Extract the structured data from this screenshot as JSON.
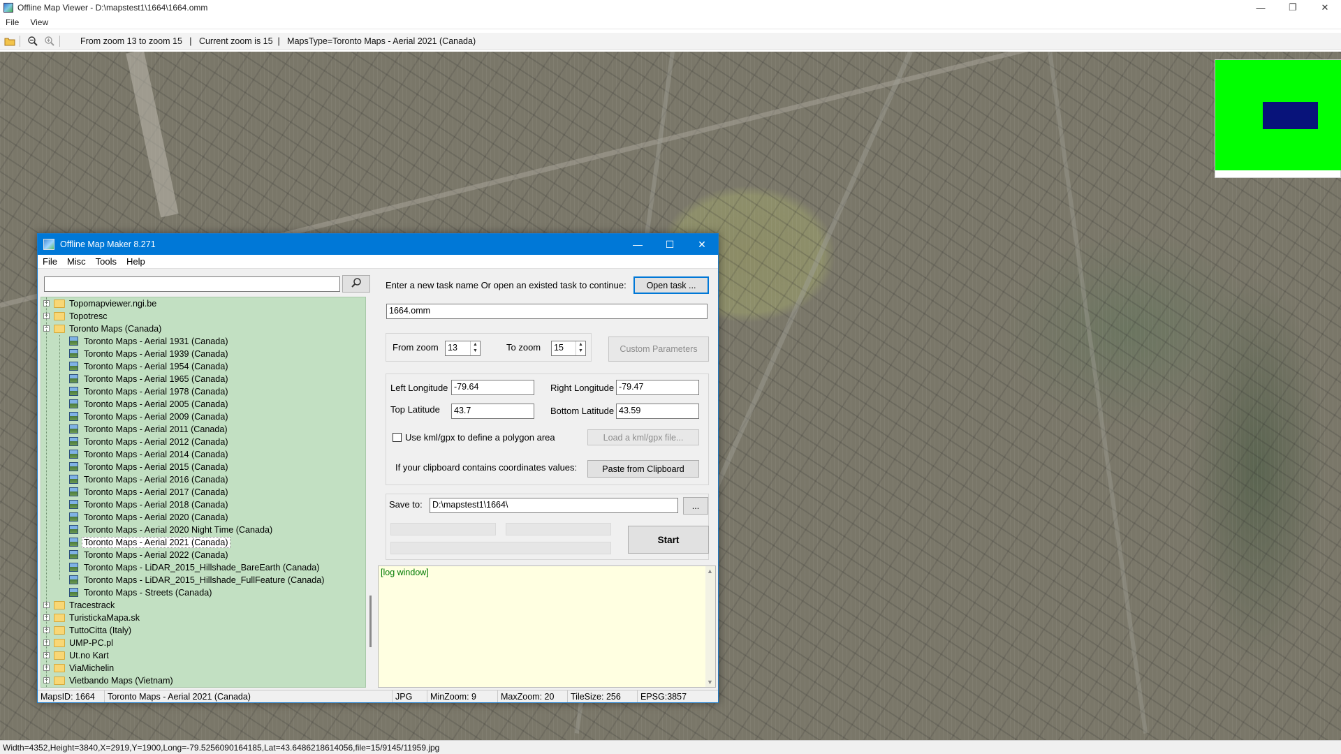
{
  "viewer": {
    "title": "Offline Map Viewer - D:\\mapstest1\\1664\\1664.omm",
    "menu": [
      "File",
      "View"
    ],
    "toolbar_info": "From zoom 13 to zoom 15   |   Current zoom is 15  |   MapsType=Toronto Maps - Aerial 2021 (Canada)",
    "status": "Width=4352,Height=3840,X=2919,Y=1900,Long=-79.5256090164185,Lat=43.6486218614056,file=15/9145/11959.jpg",
    "win_buttons": {
      "minimize": "—",
      "restore": "❐",
      "close": "✕"
    }
  },
  "dialog": {
    "title": "Offline Map Maker 8.271",
    "menu": [
      "File",
      "Misc",
      "Tools",
      "Help"
    ],
    "search_value": "",
    "tree": [
      {
        "label": "Topomapviewer.ngi.be",
        "type": "folder",
        "expanded": false
      },
      {
        "label": "Topotresc",
        "type": "folder",
        "expanded": false
      },
      {
        "label": "Toronto Maps (Canada)",
        "type": "folder",
        "expanded": true
      },
      {
        "label": "Toronto Maps - Aerial 1931 (Canada)",
        "type": "map"
      },
      {
        "label": "Toronto Maps - Aerial 1939 (Canada)",
        "type": "map"
      },
      {
        "label": "Toronto Maps - Aerial 1954 (Canada)",
        "type": "map"
      },
      {
        "label": "Toronto Maps - Aerial 1965 (Canada)",
        "type": "map"
      },
      {
        "label": "Toronto Maps - Aerial 1978 (Canada)",
        "type": "map"
      },
      {
        "label": "Toronto Maps - Aerial 2005 (Canada)",
        "type": "map"
      },
      {
        "label": "Toronto Maps - Aerial 2009 (Canada)",
        "type": "map"
      },
      {
        "label": "Toronto Maps - Aerial 2011 (Canada)",
        "type": "map"
      },
      {
        "label": "Toronto Maps - Aerial 2012 (Canada)",
        "type": "map"
      },
      {
        "label": "Toronto Maps - Aerial 2014 (Canada)",
        "type": "map"
      },
      {
        "label": "Toronto Maps - Aerial 2015 (Canada)",
        "type": "map"
      },
      {
        "label": "Toronto Maps - Aerial 2016 (Canada)",
        "type": "map"
      },
      {
        "label": "Toronto Maps - Aerial 2017 (Canada)",
        "type": "map"
      },
      {
        "label": "Toronto Maps - Aerial 2018 (Canada)",
        "type": "map"
      },
      {
        "label": "Toronto Maps - Aerial 2020 (Canada)",
        "type": "map"
      },
      {
        "label": "Toronto Maps - Aerial 2020 Night Time (Canada)",
        "type": "map"
      },
      {
        "label": "Toronto Maps - Aerial 2021 (Canada)",
        "type": "map",
        "selected": true
      },
      {
        "label": "Toronto Maps - Aerial 2022 (Canada)",
        "type": "map"
      },
      {
        "label": "Toronto Maps - LiDAR_2015_Hillshade_BareEarth (Canada)",
        "type": "map"
      },
      {
        "label": "Toronto Maps - LiDAR_2015_Hillshade_FullFeature (Canada)",
        "type": "map"
      },
      {
        "label": "Toronto Maps - Streets (Canada)",
        "type": "map"
      },
      {
        "label": "Tracestrack",
        "type": "folder",
        "expanded": false
      },
      {
        "label": "TuristickaMapa.sk",
        "type": "folder",
        "expanded": false
      },
      {
        "label": "TuttoCitta (Italy)",
        "type": "folder",
        "expanded": false
      },
      {
        "label": "UMP-PC.pl",
        "type": "folder",
        "expanded": false
      },
      {
        "label": "Ut.no Kart",
        "type": "folder",
        "expanded": false
      },
      {
        "label": "ViaMichelin",
        "type": "folder",
        "expanded": false
      },
      {
        "label": "Vietbando Maps (Vietnam)",
        "type": "folder",
        "expanded": false
      }
    ],
    "task_prompt": "Enter a new task name Or open an existed task to continue:",
    "open_task_button": "Open task ...",
    "task_name": "1664.omm",
    "from_zoom_label": "From zoom",
    "from_zoom": "13",
    "to_zoom_label": "To zoom",
    "to_zoom": "15",
    "custom_params_button": "Custom Parameters",
    "left_lon_label": "Left Longitude",
    "left_lon": "-79.64",
    "right_lon_label": "Right Longitude",
    "right_lon": "-79.47",
    "top_lat_label": "Top Latitude",
    "top_lat": "43.7",
    "bottom_lat_label": "Bottom Latitude",
    "bottom_lat": "43.59",
    "kml_checkbox_label": "Use kml/gpx to define a polygon area",
    "load_kml_button": "Load a kml/gpx file...",
    "clipboard_label": "If your clipboard contains coordinates values:",
    "paste_button": "Paste from Clipboard",
    "save_to_label": "Save to:",
    "save_to": "D:\\mapstest1\\1664\\",
    "browse_button": "...",
    "start_button": "Start",
    "log_text": "[log window]",
    "status": {
      "maps_id": "MapsID: 1664",
      "map_name": "Toronto Maps - Aerial 2021 (Canada)",
      "format": "JPG",
      "min_zoom": "MinZoom: 9",
      "max_zoom": "MaxZoom: 20",
      "tile_size": "TileSize: 256",
      "epsg": "EPSG:3857"
    }
  },
  "minimap": {
    "background_color": "#00ff00",
    "view_color": "#08137a"
  }
}
